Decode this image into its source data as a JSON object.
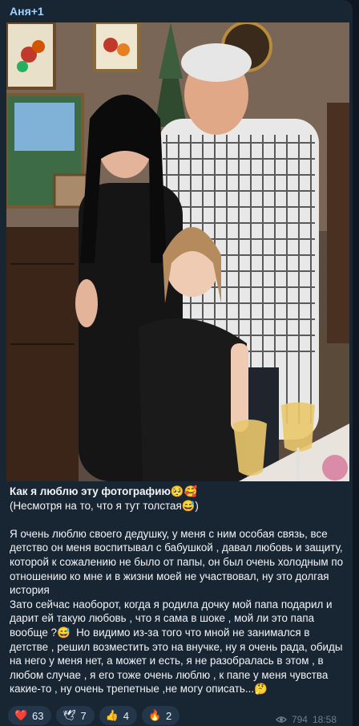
{
  "message": {
    "sender": "Аня+1",
    "title": "Как я люблю эту фотографию🥺🥰",
    "line2": "(Несмотря на то, что я тут толстая😅)",
    "paragraph1": "Я очень люблю своего дедушку, у меня с ним особая связь, все детство он меня воспитывал с бабушкой , давал любовь и защиту, которой к сожалению не было от папы, он был очень холодным по отношению ко мне и в жизни моей не участвовал, ну это долгая история",
    "paragraph2": "Зато сейчас наоборот, когда я родила дочку мой папа подарил и дарит ей такую любовь , что я сама в шоке , мой ли это папа вообще ?😅  Но видимо из-за того что мной не занимался в детстве , решил возместить это на внучке, ну я очень рада, обиды на него у меня нет, а может и есть, я не разобралась в этом , в любом случае , я его тоже очень люблю , к папе у меня чувства какие-то , ну очень трепетные ,не могу описать...🤔"
  },
  "reactions": [
    {
      "emoji": "❤️",
      "icon": "heart-icon",
      "count": "63"
    },
    {
      "emoji": "🕊",
      "icon": "dove-icon",
      "count": "7"
    },
    {
      "emoji": "👍",
      "icon": "thumbs-up-icon",
      "count": "4"
    },
    {
      "emoji": "🔥",
      "icon": "fire-icon",
      "count": "2"
    }
  ],
  "meta": {
    "views": "794",
    "time": "18:58",
    "views_icon": "eye-icon"
  },
  "colors": {
    "background": "#0e1621",
    "bubble": "#182533",
    "sender": "#9fd3ff",
    "reaction_bg": "#23364a"
  }
}
